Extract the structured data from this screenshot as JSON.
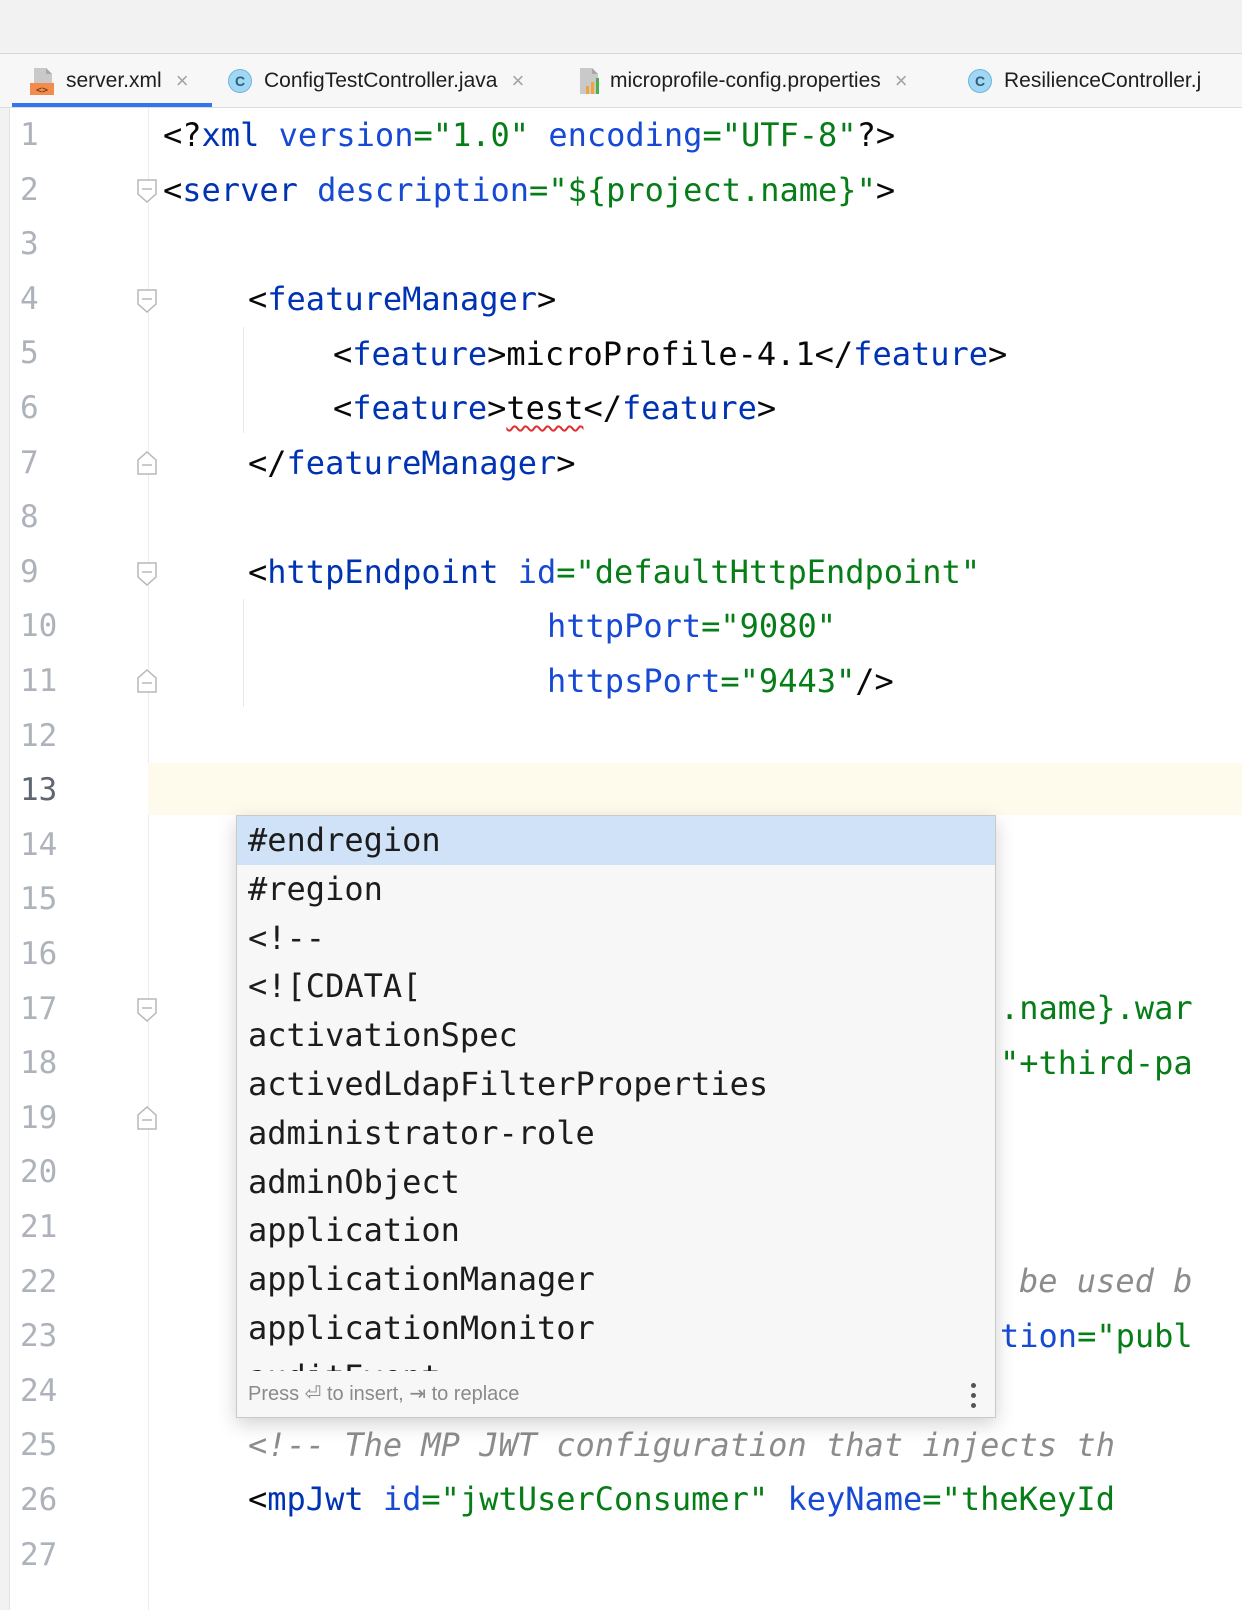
{
  "tabs": [
    {
      "label": "server.xml",
      "icon": "xml-file-icon",
      "active": true
    },
    {
      "label": "ConfigTestController.java",
      "icon": "java-class-icon",
      "active": false
    },
    {
      "label": "microprofile-config.properties",
      "icon": "properties-file-icon",
      "active": false
    },
    {
      "label": "ResilienceController.j",
      "icon": "java-class-icon",
      "active": false
    }
  ],
  "tab_close_glyph": "×",
  "class_icon_letter": "C",
  "editor": {
    "current_line": 13,
    "line_numbers": [
      "1",
      "2",
      "3",
      "4",
      "5",
      "6",
      "7",
      "8",
      "9",
      "10",
      "11",
      "12",
      "13",
      "14",
      "15",
      "16",
      "17",
      "18",
      "19",
      "20",
      "21",
      "22",
      "23",
      "24",
      "25",
      "26",
      "27"
    ],
    "code": {
      "l1": {
        "a": "<?",
        "b": "xml",
        "c": " ",
        "d": "version",
        "e": "=",
        "f": "\"1.0\"",
        "g": " ",
        "h": "encoding",
        "i": "=",
        "j": "\"UTF-8\"",
        "k": "?>"
      },
      "l2": {
        "a": "<",
        "b": "server",
        "c": " ",
        "d": "description",
        "e": "=",
        "f": "\"${project.name}\"",
        "g": ">"
      },
      "l4": {
        "a": "<",
        "b": "featureManager",
        "c": ">"
      },
      "l5": {
        "a": "<",
        "b": "feature",
        "c": ">",
        "d": "microProfile-4.1",
        "e": "</",
        "f": "feature",
        "g": ">"
      },
      "l6": {
        "a": "<",
        "b": "feature",
        "c": ">",
        "d": "test",
        "e": "</",
        "f": "feature",
        "g": ">"
      },
      "l7": {
        "a": "</",
        "b": "featureManager",
        "c": ">"
      },
      "l9": {
        "a": "<",
        "b": "httpEndpoint",
        "c": " ",
        "d": "id",
        "e": "=",
        "f": "\"defaultHttpEndpoint\""
      },
      "l10": {
        "a": "httpPort",
        "b": "=",
        "c": "\"9080\""
      },
      "l11": {
        "a": "httpsPort",
        "b": "=",
        "c": "\"9443\"",
        "d": "/>"
      },
      "l17": {
        "a": ".name}.war"
      },
      "l18": {
        "a": "\"+third-pa"
      },
      "l22": {
        "a": "be used b"
      },
      "l23": {
        "a": "tion",
        "b": "=",
        "c": "\"publ"
      },
      "l25": {
        "a": "<!-- The MP JWT configuration that injects th"
      },
      "l26": {
        "a": "<",
        "b": "mpJwt",
        "c": " ",
        "d": "id",
        "e": "=",
        "f": "\"jwtUserConsumer\"",
        "g": " ",
        "h": "keyName",
        "i": "=",
        "j": "\"theKeyId"
      }
    }
  },
  "completion": {
    "items": [
      "#endregion",
      "#region",
      "<!--",
      "<![CDATA[",
      "activationSpec",
      "activedLdapFilterProperties",
      "administrator-role",
      "adminObject",
      "application",
      "applicationManager",
      "applicationMonitor",
      "auditEvent"
    ],
    "selected_index": 0,
    "hint": "Press ⏎ to insert, ⇥ to replace",
    "more_icon": "vertical-ellipsis-icon"
  }
}
